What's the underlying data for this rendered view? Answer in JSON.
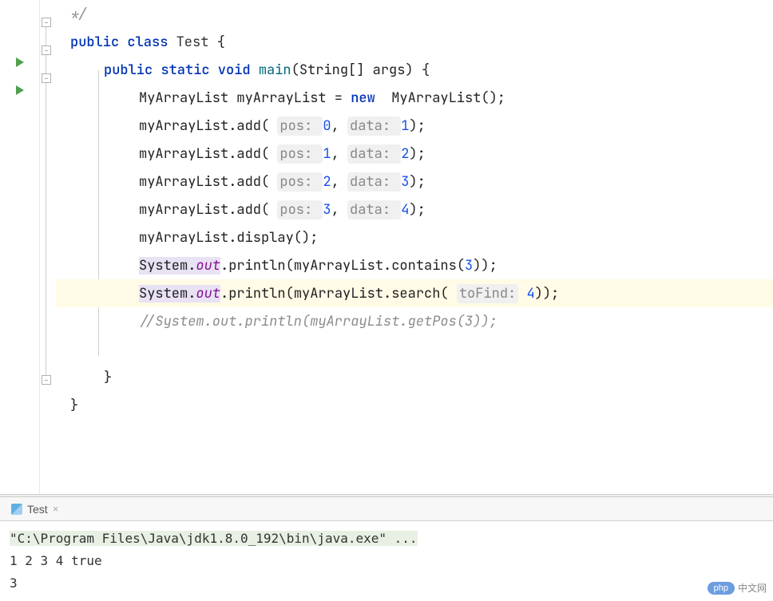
{
  "code": {
    "comment_end": "*/",
    "line_class": "public class Test {",
    "line_method": "public static void main(String[] args) {",
    "line_ctor": "MyArrayList myArrayList = new  MyArrayList();",
    "add_calls": [
      {
        "pos": "0",
        "data": "1"
      },
      {
        "pos": "1",
        "data": "2"
      },
      {
        "pos": "2",
        "data": "3"
      },
      {
        "pos": "3",
        "data": "4"
      }
    ],
    "line_display": "myArrayList.display();",
    "sys_field": "System.out",
    "println_contains_prefix": ".println(myArrayList.contains(",
    "contains_arg": "3",
    "println_search_prefix": ".println(myArrayList.search( ",
    "search_hint": "toFind:",
    "search_arg": "4",
    "comment_line": "//System.out.println(myArrayList.getPos(3));",
    "close1": "}",
    "close2": "}"
  },
  "output": {
    "tab_name": "Test",
    "cmd": "\"C:\\Program Files\\Java\\jdk1.8.0_192\\bin\\java.exe\" ...",
    "line1": "1 2 3 4 true",
    "line2": "3"
  },
  "watermark": {
    "badge": "php",
    "text": "中文网"
  }
}
